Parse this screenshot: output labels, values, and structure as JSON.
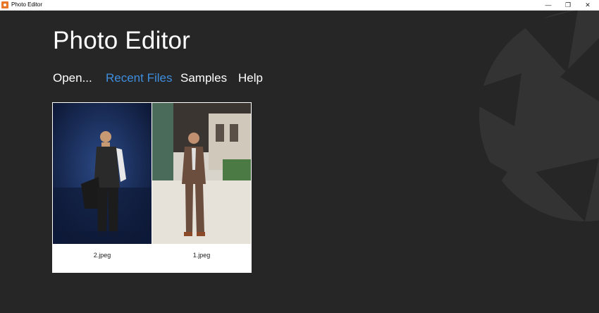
{
  "window": {
    "title": "Photo Editor",
    "minimize_glyph": "—",
    "maximize_glyph": "❐",
    "close_glyph": "✕"
  },
  "main": {
    "title": "Photo Editor",
    "nav": [
      {
        "label": "Open...",
        "active": false
      },
      {
        "label": "Recent Files",
        "active": true
      },
      {
        "label": "Samples",
        "active": false
      },
      {
        "label": "Help",
        "active": false
      }
    ],
    "recent_files": [
      {
        "name": "2.jpeg"
      },
      {
        "name": "1.jpeg"
      }
    ]
  },
  "colors": {
    "background": "#262626",
    "accent": "#3e8ede",
    "text": "#ffffff"
  }
}
